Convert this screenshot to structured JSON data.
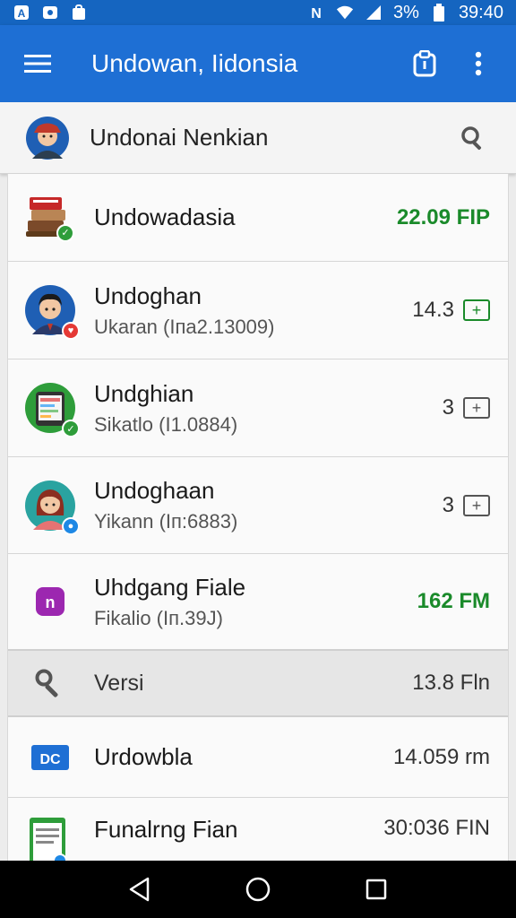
{
  "status_bar": {
    "left_icons": [
      "font-a-icon",
      "photo-icon",
      "bag-icon"
    ],
    "right_icons": [
      "nfc-icon",
      "wifi-icon",
      "signal-icon"
    ],
    "battery_text": "3%",
    "time": "39:40"
  },
  "app_bar": {
    "title": "Undowan, Iidonsia",
    "icons": [
      "menu-icon",
      "clipboard-icon",
      "more-vert-icon"
    ]
  },
  "account": {
    "name": "Undonai Nenkian",
    "search_icon": "search-icon"
  },
  "items": [
    {
      "primary": "Undowadasia",
      "secondary": "",
      "value": "22.09 FIP",
      "value_color": "#1a8a2a",
      "icon": "books-icon",
      "badge": "check-badge-icon"
    },
    {
      "primary": "Undoghan",
      "secondary": "Ukaran (Iпа2.13009)",
      "value": "14.3",
      "value_color": "#333333",
      "icon": "man-avatar-icon",
      "badge": "heart-badge-icon",
      "action": "add-box-icon"
    },
    {
      "primary": "Undghian",
      "secondary": "Sikatlo (I1.0884)",
      "value": "3",
      "value_color": "#333333",
      "icon": "phone-app-icon",
      "badge": "check-badge-icon",
      "action": "add-box-icon"
    },
    {
      "primary": "Undoghaan",
      "secondary": "Yikann (Iп:6883)",
      "value": "3",
      "value_color": "#333333",
      "icon": "woman-avatar-icon",
      "badge": "blue-badge-icon",
      "action": "add-box-icon"
    },
    {
      "primary": "Uhdgang Fiale",
      "secondary": "Fikalio (Iп.39Ј)",
      "value": "162 FM",
      "value_color": "#1a8a2a",
      "icon": "app-logo-icon"
    }
  ],
  "section": {
    "label": "Versi",
    "value": "13.8 Fln",
    "icon": "key-icon"
  },
  "items2": [
    {
      "primary": "Urdowbla",
      "value": "14.059 rm",
      "icon": "doc-logo-icon",
      "logo_text": "DC"
    },
    {
      "primary": "Funalrng Fian",
      "value": "30:036 FIN",
      "icon": "document-icon"
    }
  ],
  "nav": [
    "back-icon",
    "home-icon",
    "recents-icon"
  ]
}
